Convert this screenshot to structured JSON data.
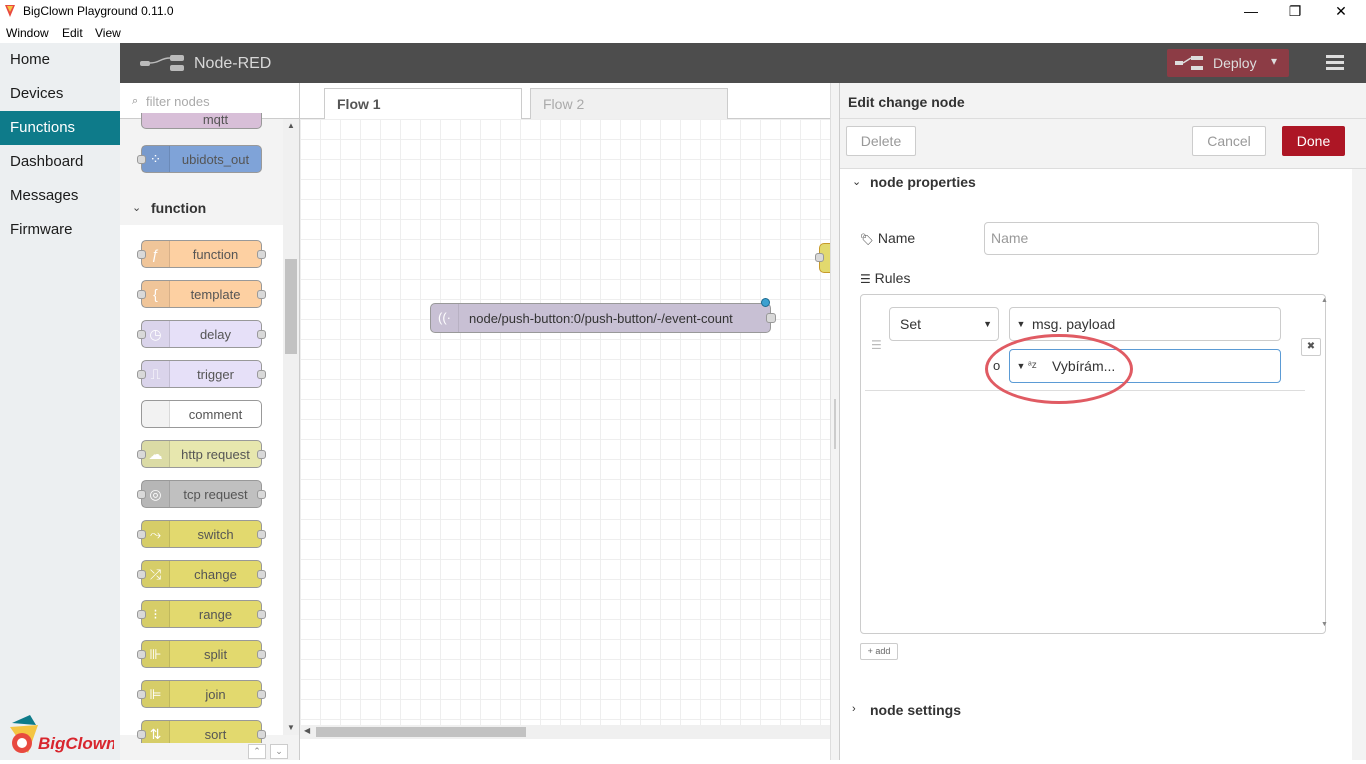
{
  "window": {
    "title": "BigClown Playground 0.11.0",
    "minimize": "—",
    "maximize": "❐",
    "close": "✕"
  },
  "menu": [
    "Window",
    "Edit",
    "View"
  ],
  "app_nav": {
    "items": [
      {
        "label": "Home",
        "active": false
      },
      {
        "label": "Devices",
        "active": false
      },
      {
        "label": "Functions",
        "active": true
      },
      {
        "label": "Dashboard",
        "active": false
      },
      {
        "label": "Messages",
        "active": false
      },
      {
        "label": "Firmware",
        "active": false
      }
    ],
    "logo_text": "BigClown"
  },
  "header": {
    "title": "Node-RED",
    "deploy_label": "Deploy"
  },
  "palette": {
    "filter_placeholder": "filter nodes",
    "top_nodes": [
      {
        "label": "mqtt",
        "color": "#d8bfd8"
      },
      {
        "label": "ubidots_out",
        "color": "#7fa3d8"
      }
    ],
    "category": "function",
    "nodes": [
      {
        "label": "function",
        "color": "#fdd0a2",
        "icon": "ƒ"
      },
      {
        "label": "template",
        "color": "#fdd0a2",
        "icon": "{"
      },
      {
        "label": "delay",
        "color": "#e6e0f8",
        "icon": "◷"
      },
      {
        "label": "trigger",
        "color": "#e6e0f8",
        "icon": "⎍"
      },
      {
        "label": "comment",
        "color": "#ffffff",
        "icon": ""
      },
      {
        "label": "http request",
        "color": "#e7e7ae",
        "icon": "☁"
      },
      {
        "label": "tcp request",
        "color": "#c0c0c0",
        "icon": "◎"
      },
      {
        "label": "switch",
        "color": "#e2d96e",
        "icon": "⤳"
      },
      {
        "label": "change",
        "color": "#e2d96e",
        "icon": "⤮"
      },
      {
        "label": "range",
        "color": "#e2d96e",
        "icon": "⁝"
      },
      {
        "label": "split",
        "color": "#e2d96e",
        "icon": "⊪"
      },
      {
        "label": "join",
        "color": "#e2d96e",
        "icon": "⊫"
      },
      {
        "label": "sort",
        "color": "#e2d96e",
        "icon": "⇅"
      }
    ]
  },
  "workspace": {
    "tabs": [
      {
        "label": "Flow 1",
        "active": true
      },
      {
        "label": "Flow 2",
        "active": false
      }
    ],
    "flow_node_label": "node/push-button:0/push-button/-/event-count"
  },
  "tray": {
    "title": "Edit change node",
    "delete_label": "Delete",
    "cancel_label": "Cancel",
    "done_label": "Done",
    "section_properties": "node properties",
    "name_label": "Name",
    "name_placeholder": "Name",
    "rules_label": "Rules",
    "rule": {
      "action": "Set",
      "target_prefix": "msg.",
      "target": "payload",
      "to_label": "o",
      "value": "Vybírám..."
    },
    "add_label": "add",
    "section_settings": "node settings"
  },
  "colors": {
    "accent_nav": "#0e7b8a",
    "deploy": "#8c3c45",
    "done": "#ad1625",
    "highlight": "#e05b63"
  }
}
